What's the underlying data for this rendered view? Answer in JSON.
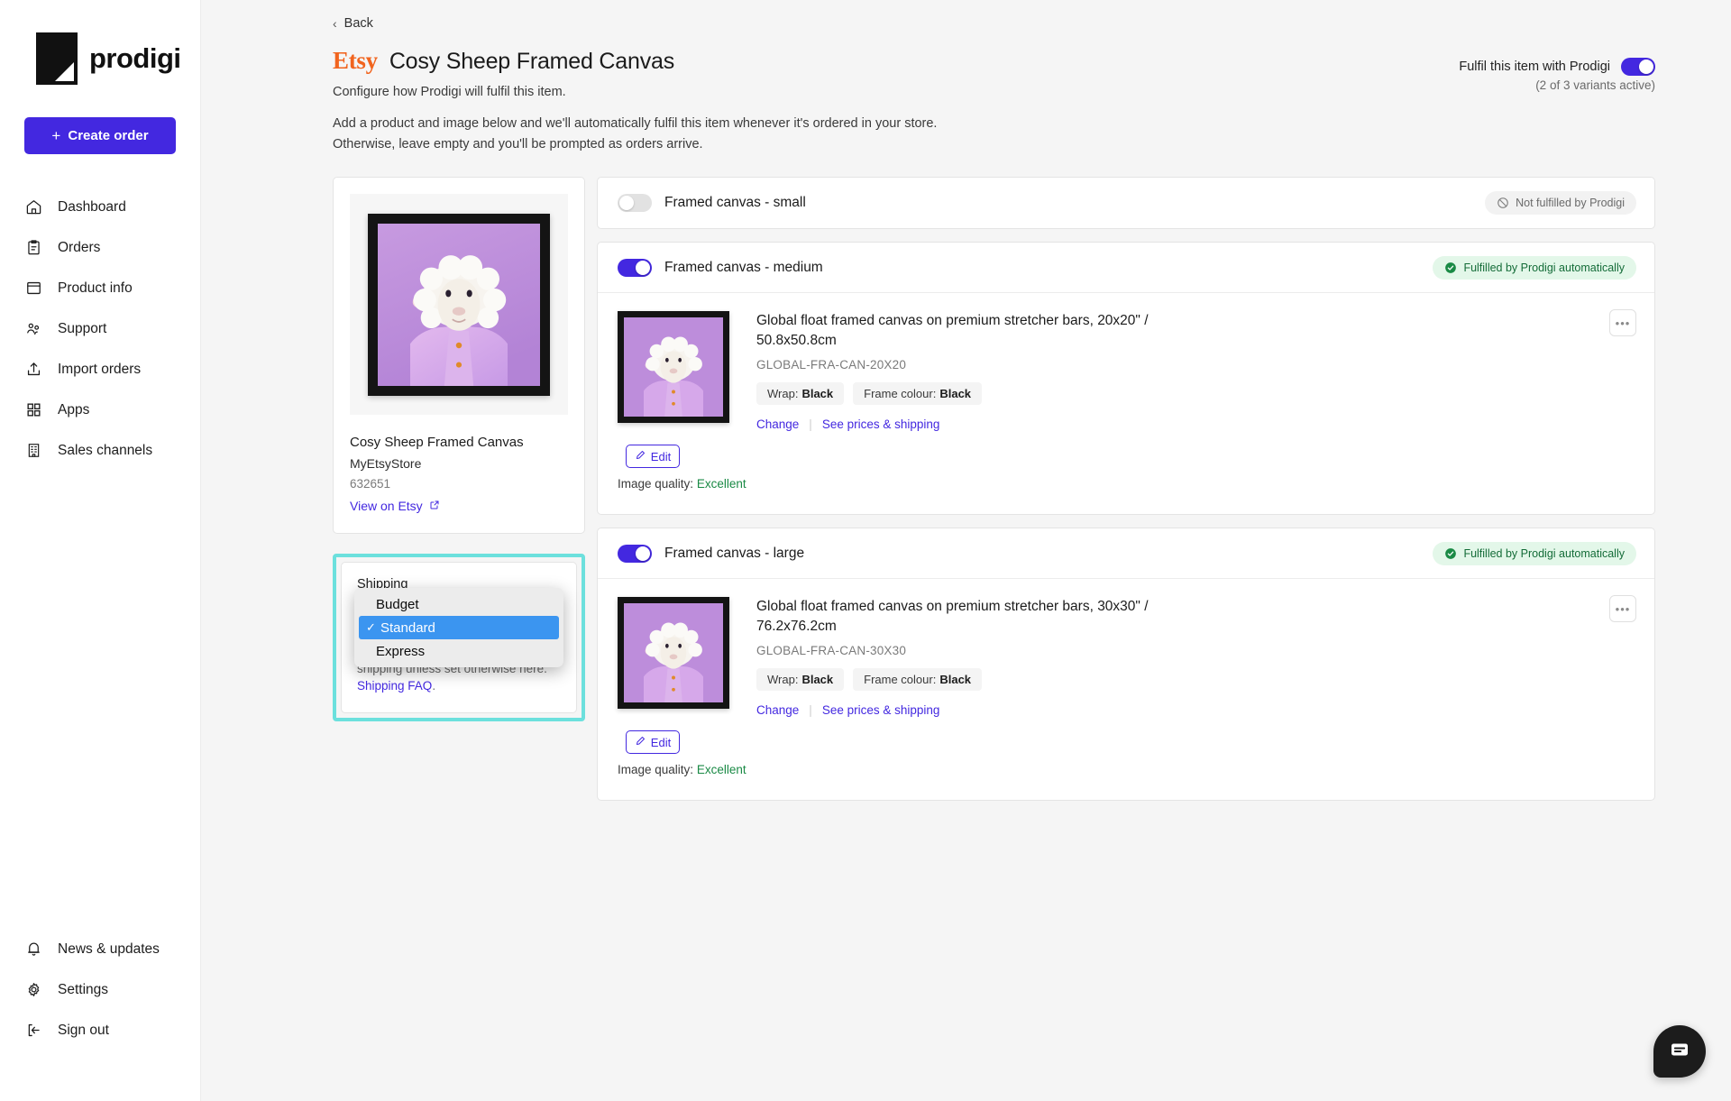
{
  "sidebar": {
    "brand": "prodigi",
    "create_order_label": "Create order",
    "items": [
      {
        "label": "Dashboard",
        "icon": "home-icon"
      },
      {
        "label": "Orders",
        "icon": "clipboard-icon"
      },
      {
        "label": "Product info",
        "icon": "archive-icon"
      },
      {
        "label": "Support",
        "icon": "people-icon"
      },
      {
        "label": "Import orders",
        "icon": "upload-icon"
      },
      {
        "label": "Apps",
        "icon": "grid-icon"
      },
      {
        "label": "Sales channels",
        "icon": "building-icon"
      }
    ],
    "bottom_items": [
      {
        "label": "News & updates",
        "icon": "bell-icon"
      },
      {
        "label": "Settings",
        "icon": "gear-icon"
      },
      {
        "label": "Sign out",
        "icon": "sign-out-icon"
      }
    ]
  },
  "header": {
    "back_label": "Back",
    "channel_logo": "Etsy",
    "title": "Cosy Sheep Framed Canvas",
    "subtitle": "Configure how Prodigi will fulfil this item.",
    "description_line1": "Add a product and image below and we'll automatically fulfil this item whenever it's ordered in your store.",
    "description_line2": "Otherwise, leave empty and you'll be prompted as orders arrive.",
    "fulfil_toggle_label": "Fulfil this item with Prodigi",
    "fulfil_variants_note": "(2 of 3 variants active)",
    "fulfil_toggle_on": true
  },
  "product": {
    "name": "Cosy Sheep Framed Canvas",
    "store": "MyEtsyStore",
    "id": "632651",
    "view_link": "View on Etsy"
  },
  "shipping": {
    "label": "Shipping",
    "selected": "Standard",
    "options": [
      "Budget",
      "Standard",
      "Express"
    ],
    "note_prefix": "All Etsy products use Standard shipping unless set otherwise here. ",
    "note_link": "Shipping FAQ",
    "note_suffix": "."
  },
  "colors": {
    "brand_purple": "#4328e0",
    "etsy_orange": "#f1641e",
    "success_green": "#146c38",
    "highlight_cyan": "#6ce0dd",
    "dropdown_selected_blue": "#3b95f0"
  },
  "variants": [
    {
      "name": "Framed canvas - small",
      "enabled": false,
      "status_label": "Not fulfilled by Prodigi",
      "status_type": "none"
    },
    {
      "name": "Framed canvas - medium",
      "enabled": true,
      "status_label": "Fulfilled by Prodigi automatically",
      "status_type": "ok",
      "product_title": "Global float framed canvas on premium stretcher bars, 20x20\" / 50.8x50.8cm",
      "sku": "GLOBAL-FRA-CAN-20X20",
      "attributes": [
        {
          "key": "Wrap:",
          "value": "Black"
        },
        {
          "key": "Frame colour:",
          "value": "Black"
        }
      ],
      "change_label": "Change",
      "prices_label": "See prices & shipping",
      "edit_label": "Edit",
      "image_quality_label": "Image quality:",
      "image_quality_value": "Excellent",
      "menu_label": "•••"
    },
    {
      "name": "Framed canvas - large",
      "enabled": true,
      "status_label": "Fulfilled by Prodigi automatically",
      "status_type": "ok",
      "product_title": "Global float framed canvas on premium stretcher bars, 30x30\" / 76.2x76.2cm",
      "sku": "GLOBAL-FRA-CAN-30X30",
      "attributes": [
        {
          "key": "Wrap:",
          "value": "Black"
        },
        {
          "key": "Frame colour:",
          "value": "Black"
        }
      ],
      "change_label": "Change",
      "prices_label": "See prices & shipping",
      "edit_label": "Edit",
      "image_quality_label": "Image quality:",
      "image_quality_value": "Excellent",
      "menu_label": "•••"
    }
  ],
  "chat": {
    "icon": "chat-icon"
  }
}
